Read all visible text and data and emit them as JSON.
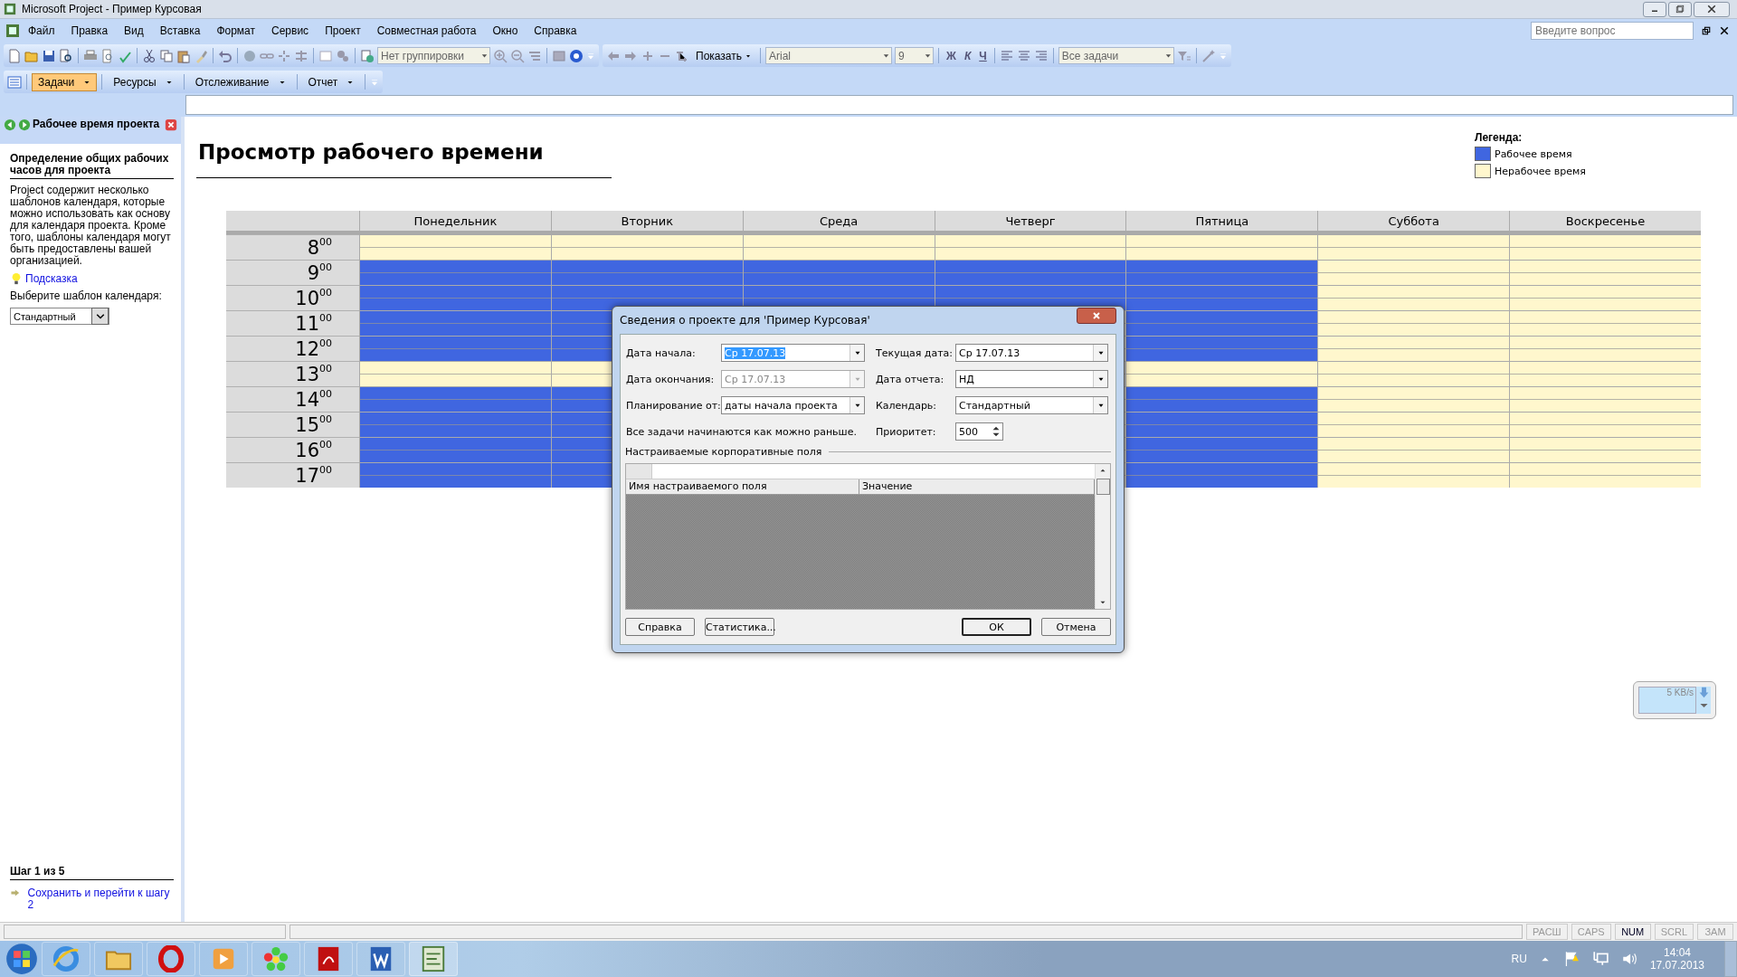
{
  "window": {
    "title": "Microsoft Project - Пример Курсовая"
  },
  "menu": [
    "Файл",
    "Правка",
    "Вид",
    "Вставка",
    "Формат",
    "Сервис",
    "Проект",
    "Совместная работа",
    "Окно",
    "Справка"
  ],
  "help_search": {
    "placeholder": "Введите вопрос"
  },
  "toolbar": {
    "grouping": "Нет группировки",
    "show": "Показать",
    "font": "Arial",
    "size": "9",
    "format_buttons": [
      "Ж",
      "К",
      "Ч"
    ],
    "filter": "Все задачи"
  },
  "guide_toolbar": [
    {
      "label": "Задачи",
      "selected": true
    },
    {
      "label": "Ресурсы",
      "selected": false
    },
    {
      "label": "Отслеживание",
      "selected": false
    },
    {
      "label": "Отчет",
      "selected": false
    }
  ],
  "side_pane": {
    "title": "Рабочее время проекта",
    "heading": "Определение общих рабочих часов для проекта",
    "text": "Project содержит несколько шаблонов календаря, которые можно использовать как основу для календаря проекта. Кроме того, шаблоны календаря могут быть предоставлены вашей организацией.",
    "hint_link": "Подсказка",
    "template_label": "Выберите шаблон календаря:",
    "template_value": "Стандартный",
    "step": "Шаг 1 из 5",
    "next_link": "Сохранить и перейти к шагу 2"
  },
  "view": {
    "title": "Просмотр рабочего времени",
    "legend": {
      "title": "Легенда:",
      "items": [
        {
          "label": "Рабочее время",
          "color": "#4066e0"
        },
        {
          "label": "Нерабочее время",
          "color": "#fff7cd"
        }
      ]
    },
    "hours": [
      "8$^{00}$",
      "9$^{00}$",
      "10$^{00}$",
      "11$^{00}$",
      "12$^{00}$",
      "13$^{00}$",
      "14$^{00}$",
      "15$^{00}$",
      "16$^{00}$",
      "17$^{00}$"
    ],
    "days": [
      {
        "name": "Понедельник",
        "working": [
          false,
          true,
          true,
          true,
          true,
          false,
          true,
          true,
          true,
          true
        ]
      },
      {
        "name": "Вторник",
        "working": [
          false,
          true,
          true,
          true,
          true,
          false,
          true,
          true,
          true,
          true
        ]
      },
      {
        "name": "Среда",
        "working": [
          false,
          true,
          true
        ]
      },
      {
        "name": "Четверг",
        "working": [
          false,
          true,
          true
        ]
      },
      {
        "name": "Пятница",
        "working": [
          false,
          true,
          true,
          true,
          true,
          false,
          true,
          true,
          true,
          true
        ]
      },
      {
        "name": "Суббота",
        "working": [
          false,
          false,
          false,
          false,
          false,
          false,
          false,
          false,
          false,
          false
        ]
      },
      {
        "name": "Воскресенье",
        "working": [
          false,
          false,
          false,
          false,
          false,
          false,
          false,
          false,
          false,
          false
        ]
      }
    ]
  },
  "dialog": {
    "title": "Сведения о проекте для 'Пример Курсовая'",
    "fields": [
      {
        "label": "Дата начала:",
        "value": "Ср 17.07.13",
        "kind": "combo",
        "disabled": false,
        "highlighted": true
      },
      {
        "label": "Текущая дата:",
        "value": "Ср 17.07.13",
        "kind": "combo",
        "disabled": false,
        "highlighted": false
      },
      {
        "label": "Дата окончания:",
        "value": "Ср 17.07.13",
        "kind": "combo",
        "disabled": true,
        "highlighted": false
      },
      {
        "label": "Дата отчета:",
        "value": "НД",
        "kind": "combo",
        "disabled": false,
        "highlighted": false
      },
      {
        "label": "Планирование от:",
        "value": "даты начала проекта",
        "kind": "combo",
        "disabled": false,
        "highlighted": false
      },
      {
        "label": "Календарь:",
        "value": "Стандартный",
        "kind": "combo",
        "disabled": false,
        "highlighted": false
      }
    ],
    "note": "Все задачи начинаются как можно раньше.",
    "priority": {
      "label": "Приоритет:",
      "value": "500"
    },
    "section": "Настраиваемые корпоративные поля",
    "columns": [
      "Имя настраиваемого поля",
      "Значение"
    ],
    "buttons": [
      {
        "label": "Справка",
        "default": false
      },
      {
        "label": "Статистика...",
        "default": false
      },
      {
        "label": "ОК",
        "default": true
      },
      {
        "label": "Отмена",
        "default": false
      }
    ]
  },
  "network_widget": {
    "speed": "5 KB/s"
  },
  "status_bar": [
    {
      "label": "РАСШ",
      "on": false
    },
    {
      "label": "CAPS",
      "on": false
    },
    {
      "label": "NUM",
      "on": true
    },
    {
      "label": "SCRL",
      "on": false
    },
    {
      "label": "ЗАМ",
      "on": false
    }
  ],
  "tray": {
    "language": "RU",
    "time": "14:04",
    "date": "17.07.2013"
  }
}
